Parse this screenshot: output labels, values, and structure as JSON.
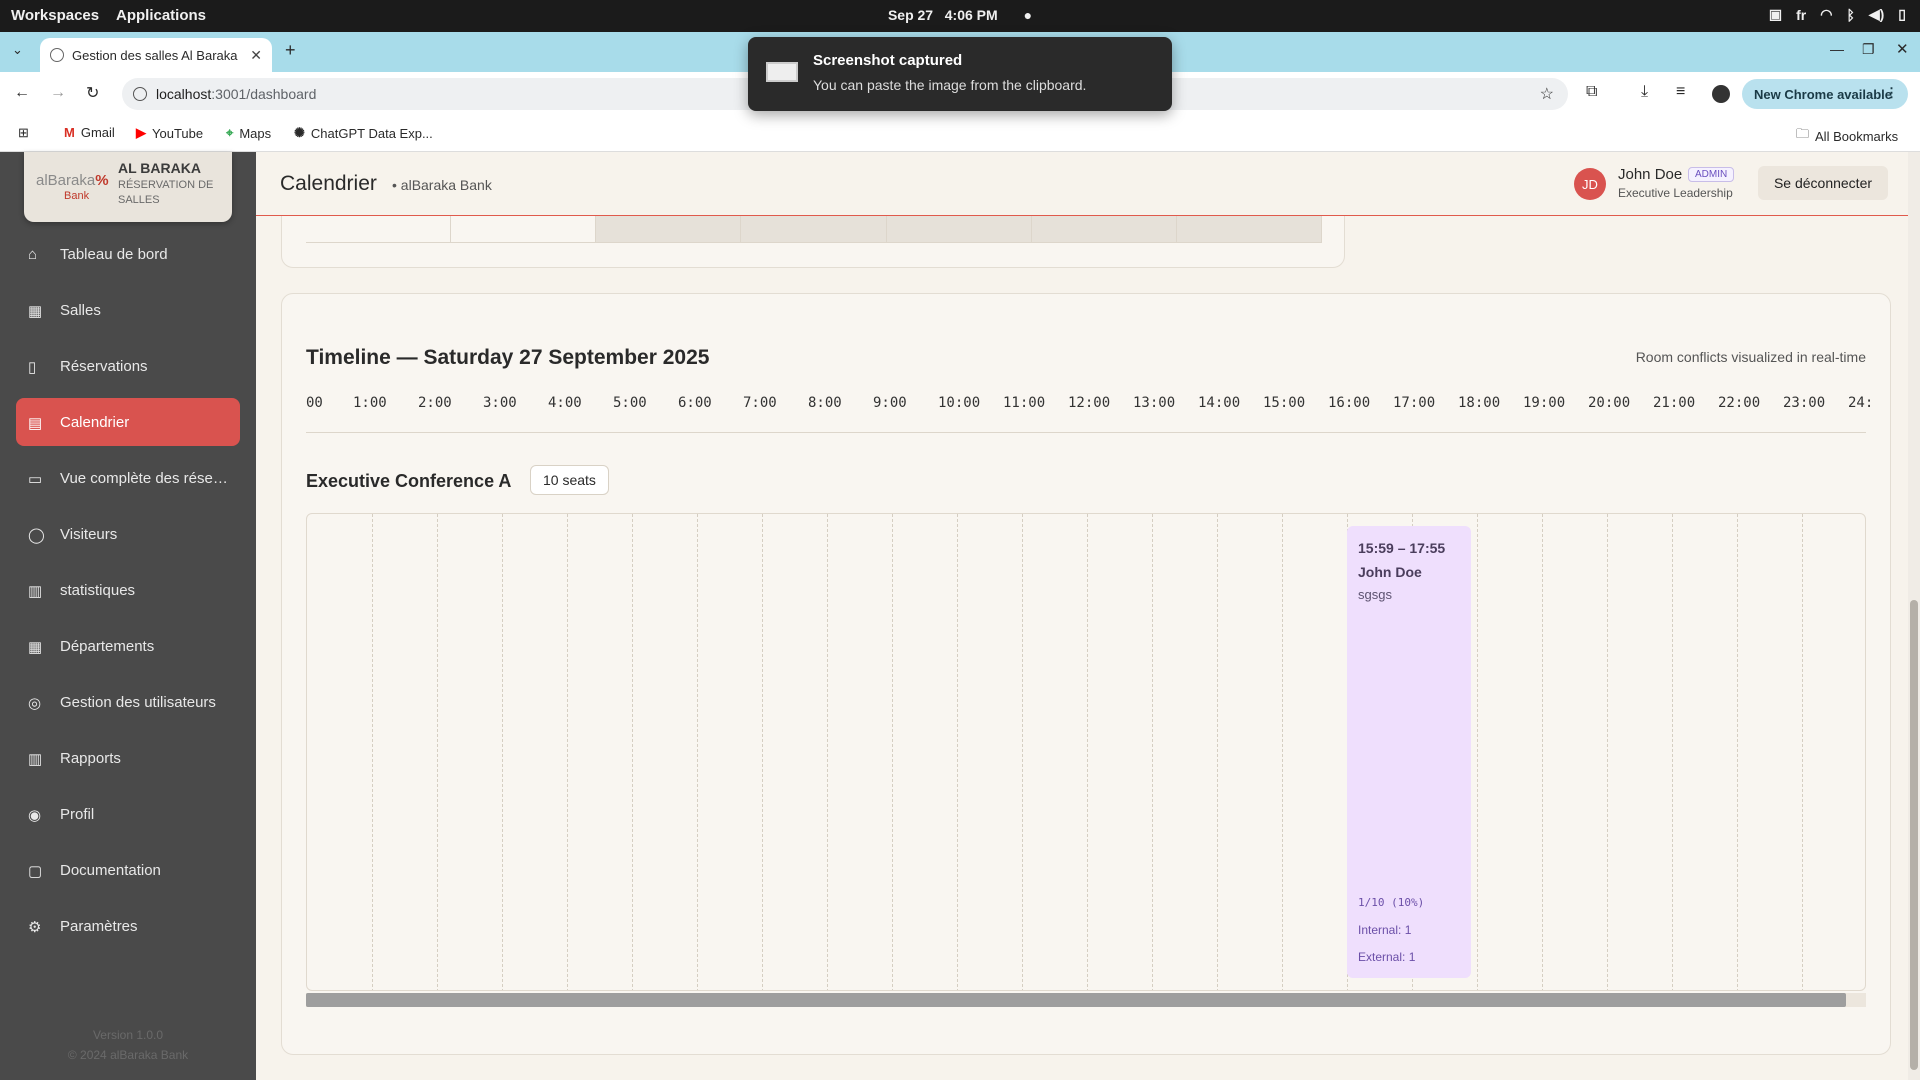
{
  "os": {
    "workspaces": "Workspaces",
    "applications": "Applications",
    "date": "Sep 27",
    "time": "4:06 PM",
    "lang": "fr"
  },
  "browser": {
    "tab_title": "Gestion des salles Al Baraka",
    "url_host": "localhost",
    "url_path": ":3001/dashboard",
    "new_chrome": "New Chrome available",
    "bookmarks": [
      "Gmail",
      "YouTube",
      "Maps",
      "ChatGPT Data Exp..."
    ],
    "all_bookmarks": "All Bookmarks"
  },
  "toast": {
    "title": "Screenshot captured",
    "message": "You can paste the image from the clipboard."
  },
  "sidebar": {
    "logo_mark": "alBaraka",
    "logo_bank": "Bank",
    "brand_title": "AL BARAKA",
    "brand_sub": "RÉSERVATION DE SALLES",
    "items": [
      {
        "label": "Tableau de bord",
        "icon": "home-icon"
      },
      {
        "label": "Salles",
        "icon": "building-icon"
      },
      {
        "label": "Réservations",
        "icon": "book-icon"
      },
      {
        "label": "Calendrier",
        "icon": "calendar-icon",
        "active": true
      },
      {
        "label": "Vue complète des réservations",
        "icon": "book-open-icon"
      },
      {
        "label": "Visiteurs",
        "icon": "user-icon"
      },
      {
        "label": "statistiques",
        "icon": "chart-icon"
      },
      {
        "label": "Départements",
        "icon": "building-icon"
      },
      {
        "label": "Gestion des utilisateurs",
        "icon": "users-icon"
      },
      {
        "label": "Rapports",
        "icon": "bar-chart-icon"
      },
      {
        "label": "Profil",
        "icon": "user-circle-icon"
      },
      {
        "label": "Documentation",
        "icon": "document-icon"
      },
      {
        "label": "Paramètres",
        "icon": "gear-icon"
      }
    ],
    "version": "Version 1.0.0",
    "copyright": "© 2024 alBaraka Bank"
  },
  "header": {
    "title": "Calendrier",
    "subtitle": "• alBaraka Bank",
    "avatar_initials": "JD",
    "user_name": "John Doe",
    "role_badge": "ADMIN",
    "department": "Executive Leadership",
    "logout": "Se déconnecter"
  },
  "timeline": {
    "title": "Timeline — Saturday 27 September 2025",
    "note": "Room conflicts visualized in real-time",
    "hours": [
      "00",
      "1:00",
      "2:00",
      "3:00",
      "4:00",
      "5:00",
      "6:00",
      "7:00",
      "8:00",
      "9:00",
      "10:00",
      "11:00",
      "12:00",
      "13:00",
      "14:00",
      "15:00",
      "16:00",
      "17:00",
      "18:00",
      "19:00",
      "20:00",
      "21:00",
      "22:00",
      "23:00",
      "24:"
    ],
    "room": {
      "name": "Executive Conference A",
      "seats": "10 seats",
      "booking": {
        "time": "15:59 – 17:55",
        "user": "John Doe",
        "title": "sgsgs",
        "occupancy": "1/10 (10%)",
        "internal": "Internal: 1",
        "external": "External: 1"
      }
    }
  },
  "colors": {
    "accent": "#d9534f",
    "sidebar": "#4a4a4a",
    "booking": "#efdffd",
    "page": "#f7f3ec"
  }
}
